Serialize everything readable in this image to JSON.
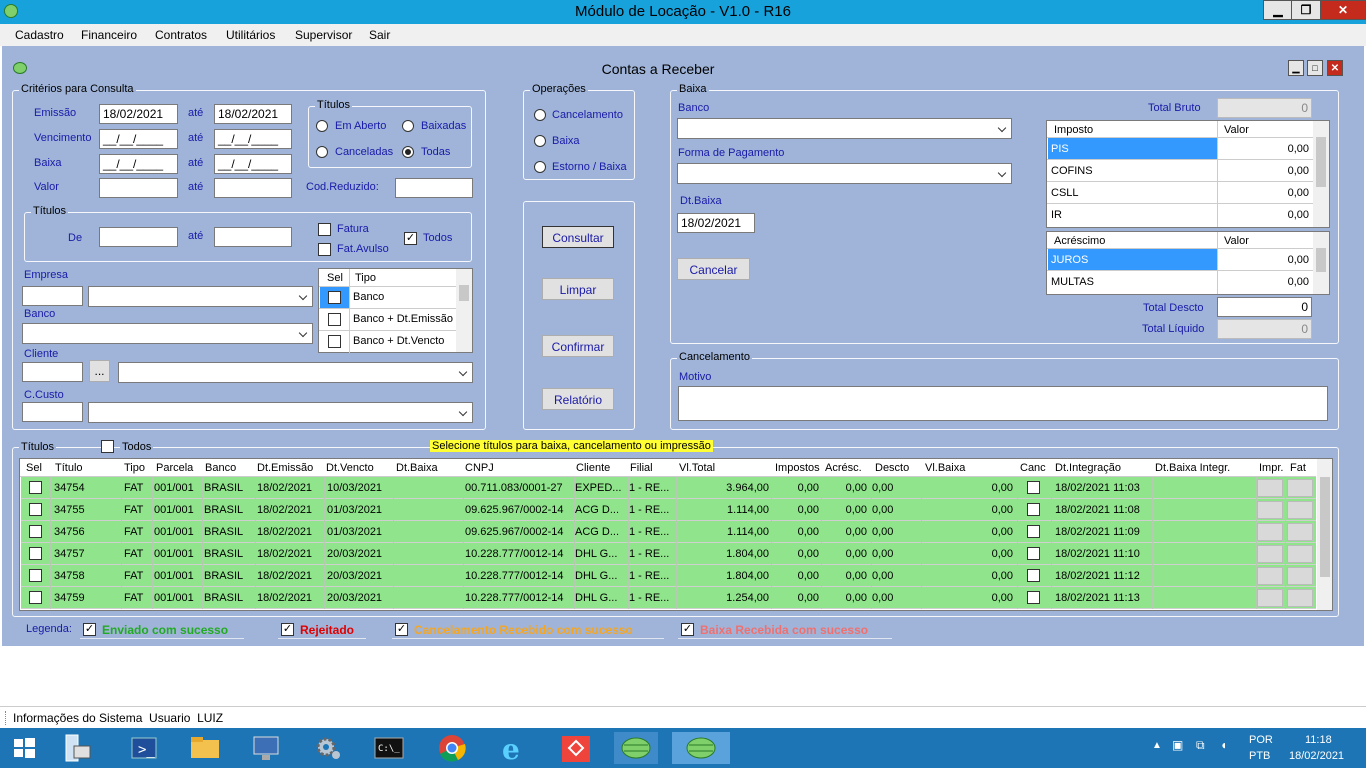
{
  "window": {
    "title": "Módulo de Locação - V1.0 - R16"
  },
  "menu": [
    "Cadastro",
    "Financeiro",
    "Contratos",
    "Utilitários",
    "Supervisor",
    "Sair"
  ],
  "form": {
    "title": "Contas a Receber"
  },
  "criterios": {
    "title": "Critérios para Consulta",
    "emissao_label": "Emissão",
    "emissao_de": "18/02/2021",
    "emissao_ate": "18/02/2021",
    "vencimento_label": "Vencimento",
    "vencimento_de": "__/__/____",
    "vencimento_ate": "__/__/____",
    "baixa_label": "Baixa",
    "baixa_de": "__/__/____",
    "baixa_ate": "__/__/____",
    "valor_label": "Valor",
    "ate_label": "até",
    "titulos_status": {
      "title": "Títulos",
      "em_aberto": "Em Aberto",
      "baixadas": "Baixadas",
      "canceladas": "Canceladas",
      "todas": "Todas"
    },
    "cod_reduzido_label": "Cod.Reduzido:",
    "titulos_box": {
      "title": "Títulos",
      "de_label": "De",
      "ate_label": "até",
      "fatura": "Fatura",
      "fat_avulso": "Fat.Avulso",
      "todos": "Todos"
    },
    "tipo_grid": {
      "col_sel": "Sel",
      "col_tipo": "Tipo",
      "rows": [
        "Banco",
        "Banco + Dt.Emissão",
        "Banco + Dt.Vencto"
      ]
    },
    "empresa_label": "Empresa",
    "banco_label": "Banco",
    "cliente_label": "Cliente",
    "cliente_btn": "...",
    "ccusto_label": "C.Custo"
  },
  "operacoes": {
    "title": "Operações",
    "cancelamento": "Cancelamento",
    "baixa": "Baixa",
    "estorno": "Estorno / Baixa"
  },
  "actions": {
    "consultar": "Consultar",
    "limpar": "Limpar",
    "confirmar": "Confirmar",
    "relatorio": "Relatório"
  },
  "baixa": {
    "title": "Baixa",
    "banco_label": "Banco",
    "forma_label": "Forma de Pagamento",
    "dt_label": "Dt.Baixa",
    "dt_value": "18/02/2021",
    "cancelar": "Cancelar",
    "total_bruto_label": "Total Bruto",
    "total_bruto": "0",
    "imposto_grid": {
      "col1": "Imposto",
      "col2": "Valor",
      "rows": [
        {
          "name": "PIS",
          "value": "0,00"
        },
        {
          "name": "COFINS",
          "value": "0,00"
        },
        {
          "name": "CSLL",
          "value": "0,00"
        },
        {
          "name": "IR",
          "value": "0,00"
        }
      ]
    },
    "acrescimo_grid": {
      "col1": "Acréscimo",
      "col2": "Valor",
      "rows": [
        {
          "name": "JUROS",
          "value": "0,00"
        },
        {
          "name": "MULTAS",
          "value": "0,00"
        }
      ]
    },
    "total_descto_label": "Total Descto",
    "total_descto": "0",
    "total_liquido_label": "Total Líquido",
    "total_liquido": "0"
  },
  "cancelamento": {
    "title": "Cancelamento",
    "motivo_label": "Motivo"
  },
  "titulos": {
    "title": "Títulos",
    "todos": "Todos",
    "banner": "Selecione títulos para baixa, cancelamento ou impressão",
    "columns": [
      "Sel",
      "Título",
      "Tipo",
      "Parcela",
      "Banco",
      "Dt.Emissão",
      "Dt.Vencto",
      "Dt.Baixa",
      "CNPJ",
      "Cliente",
      "Filial",
      "Vl.Total",
      "Impostos",
      "Acrésc.",
      "Descto",
      "Vl.Baixa",
      "Canc",
      "Dt.Integração",
      "Dt.Baixa Integr.",
      "Impr.",
      "Fat"
    ],
    "rows": [
      [
        "34754",
        "FAT",
        "001/001",
        "BRASIL",
        "18/02/2021",
        "10/03/2021",
        "",
        "00.711.083/0001-27",
        "EXPED...",
        "1 - RE...",
        "3.964,00",
        "0,00",
        "0,00",
        "0,00",
        "0,00",
        "18/02/2021 11:03"
      ],
      [
        "34755",
        "FAT",
        "001/001",
        "BRASIL",
        "18/02/2021",
        "01/03/2021",
        "",
        "09.625.967/0002-14",
        "ACG D...",
        "1 - RE...",
        "1.114,00",
        "0,00",
        "0,00",
        "0,00",
        "0,00",
        "18/02/2021 11:08"
      ],
      [
        "34756",
        "FAT",
        "001/001",
        "BRASIL",
        "18/02/2021",
        "01/03/2021",
        "",
        "09.625.967/0002-14",
        "ACG D...",
        "1 - RE...",
        "1.114,00",
        "0,00",
        "0,00",
        "0,00",
        "0,00",
        "18/02/2021 11:09"
      ],
      [
        "34757",
        "FAT",
        "001/001",
        "BRASIL",
        "18/02/2021",
        "20/03/2021",
        "",
        "10.228.777/0012-14",
        "DHL G...",
        "1 - RE...",
        "1.804,00",
        "0,00",
        "0,00",
        "0,00",
        "0,00",
        "18/02/2021 11:10"
      ],
      [
        "34758",
        "FAT",
        "001/001",
        "BRASIL",
        "18/02/2021",
        "20/03/2021",
        "",
        "10.228.777/0012-14",
        "DHL G...",
        "1 - RE...",
        "1.804,00",
        "0,00",
        "0,00",
        "0,00",
        "0,00",
        "18/02/2021 11:12"
      ],
      [
        "34759",
        "FAT",
        "001/001",
        "BRASIL",
        "18/02/2021",
        "20/03/2021",
        "",
        "10.228.777/0012-14",
        "DHL G...",
        "1 - RE...",
        "1.254,00",
        "0,00",
        "0,00",
        "0,00",
        "0,00",
        "18/02/2021 11:13"
      ]
    ]
  },
  "legenda": {
    "label": "Legenda:",
    "items": [
      {
        "text": "Enviado com sucesso",
        "color": "#22aa22"
      },
      {
        "text": "Rejeitado",
        "color": "#e00000"
      },
      {
        "text": "Cancelamento Recebido com sucesso",
        "color": "#f5a623"
      },
      {
        "text": "Baixa Recebida com sucesso",
        "color": "#f07070"
      }
    ]
  },
  "status": {
    "text": "Informações do Sistema  Usuario  LUIZ"
  },
  "taskbar": {
    "lang1": "POR",
    "lang2": "PTB",
    "time": "11:18",
    "date": "18/02/2021"
  },
  "colors": {
    "titlebar": "#17a2dc",
    "form_bg": "#9fb4d8",
    "row_green": "#90e58c",
    "selected": "#3399ff"
  }
}
